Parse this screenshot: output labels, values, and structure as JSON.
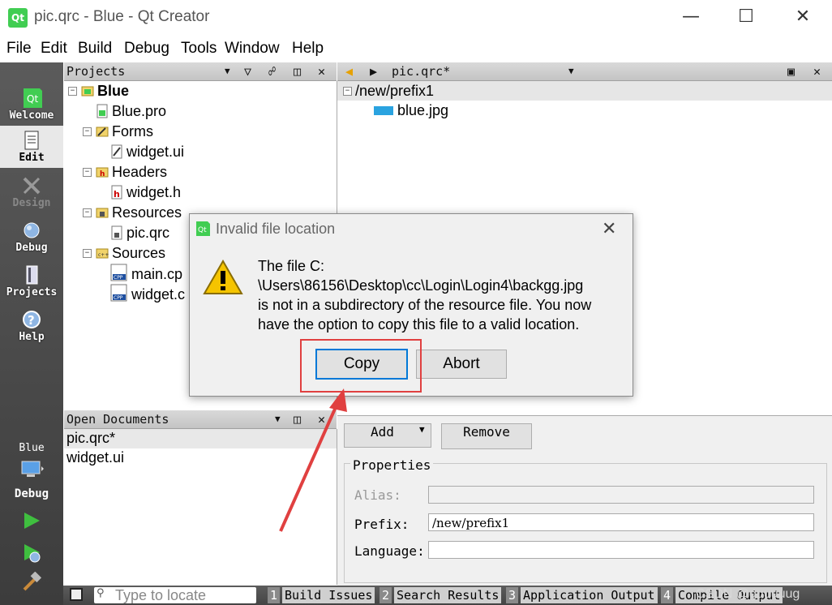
{
  "window": {
    "title": "pic.qrc - Blue - Qt Creator",
    "logo_text": "Qt",
    "controls": [
      "minimize",
      "maximize",
      "close"
    ]
  },
  "menu": [
    "File",
    "Edit",
    "Build",
    "Debug",
    "Tools",
    "Window",
    "Help"
  ],
  "modes": [
    {
      "label": "Welcome",
      "icon": "qt-logo-icon"
    },
    {
      "label": "Edit",
      "icon": "document-icon"
    },
    {
      "label": "Design",
      "icon": "design-tools-icon"
    },
    {
      "label": "Debug",
      "icon": "bug-icon"
    },
    {
      "label": "Projects",
      "icon": "projects-book-icon"
    },
    {
      "label": "Help",
      "icon": "help-icon"
    }
  ],
  "run_section": {
    "target": "Blue",
    "build_config": "Debug",
    "run_icon": "run-triangle-icon",
    "debug_run_icon": "debug-run-icon",
    "build_icon": "hammer-icon"
  },
  "projects_pane": {
    "title": "Projects",
    "tree": [
      {
        "label": "Blue",
        "icon": "project-folder-icon"
      },
      {
        "label": "Blue.pro",
        "icon": "pro-file-icon"
      },
      {
        "label": "Forms",
        "icon": "forms-folder-icon"
      },
      {
        "label": "widget.ui",
        "icon": "ui-file-icon"
      },
      {
        "label": "Headers",
        "icon": "headers-folder-icon"
      },
      {
        "label": "widget.h",
        "icon": "header-file-icon"
      },
      {
        "label": "Resources",
        "icon": "resources-folder-icon"
      },
      {
        "label": "pic.qrc",
        "icon": "qrc-file-icon"
      },
      {
        "label": "Sources",
        "icon": "sources-folder-icon"
      },
      {
        "label": "main.cp",
        "icon": "cpp-file-icon"
      },
      {
        "label": "widget.c",
        "icon": "cpp-file-icon"
      }
    ]
  },
  "open_documents": {
    "title": "Open Documents",
    "items": [
      "pic.qrc*",
      "widget.ui"
    ]
  },
  "editor": {
    "file_combo": "pic.qrc*",
    "tree": [
      {
        "label": "/new/prefix1",
        "icon": ""
      },
      {
        "label": "blue.jpg",
        "icon": "image-icon"
      }
    ],
    "add_label": "Add",
    "remove_label": "Remove",
    "properties_title": "Properties",
    "alias_label": "Alias:",
    "alias_value": "",
    "prefix_label": "Prefix:",
    "prefix_value": "/new/prefix1",
    "language_label": "Language:",
    "language_value": ""
  },
  "dialog": {
    "title": "Invalid file location",
    "message_lines": [
      "The file C:",
      "\\Users\\86156\\Desktop\\cc\\Login\\Login4\\backgg.jpg",
      "is not in a subdirectory of the resource file. You now",
      "have the option to copy this file to a valid location."
    ],
    "copy_label": "Copy",
    "abort_label": "Abort",
    "icon": "warning-icon"
  },
  "statusbar": {
    "locate_placeholder": "Type to locate",
    "tabs": [
      {
        "num": "1",
        "label": "Build Issues"
      },
      {
        "num": "2",
        "label": "Search Results"
      },
      {
        "num": "3",
        "label": "Application Output"
      },
      {
        "num": "4",
        "label": "Compile Output"
      }
    ]
  },
  "watermark": "CSDN @guuuuug",
  "colors": {
    "annotation_red": "#e04040",
    "qt_green": "#41cd52"
  }
}
